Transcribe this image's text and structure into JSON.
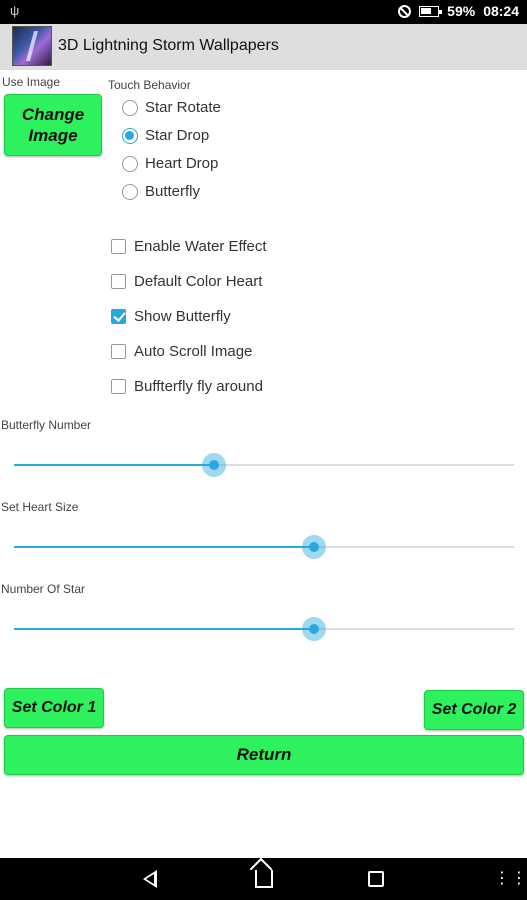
{
  "status_bar": {
    "battery": "59%",
    "time": "08:24"
  },
  "app": {
    "title": "3D Lightning Storm Wallpapers"
  },
  "use_image": {
    "label": "Use Image",
    "button": "Change Image"
  },
  "touch_behavior": {
    "label": "Touch Behavior",
    "options": [
      "Star Rotate",
      "Star Drop",
      "Heart Drop",
      "Butterfly"
    ],
    "selected": "Star Drop"
  },
  "checkboxes": [
    {
      "label": "Enable Water Effect",
      "checked": false
    },
    {
      "label": "Default Color Heart",
      "checked": false
    },
    {
      "label": "Show Butterfly",
      "checked": true
    },
    {
      "label": "Auto Scroll Image",
      "checked": false
    },
    {
      "label": "Buffterfly fly around",
      "checked": false
    }
  ],
  "sliders": [
    {
      "label": "Butterfly Number",
      "fraction": 0.4
    },
    {
      "label": "Set Heart Size",
      "fraction": 0.6
    },
    {
      "label": "Number Of Star",
      "fraction": 0.6
    }
  ],
  "buttons": {
    "set_color_1": "Set Color 1",
    "set_color_2": "Set Color 2",
    "return": "Return"
  },
  "colors": {
    "accent": "#29a8e0",
    "button_green": "#2ef15e"
  }
}
